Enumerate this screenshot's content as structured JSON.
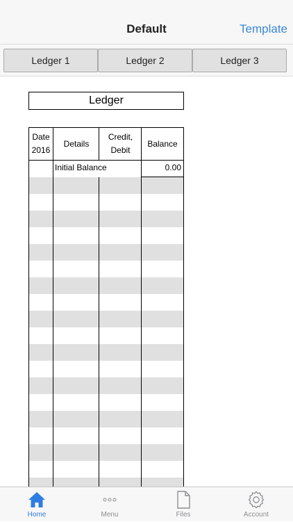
{
  "navbar": {
    "title": "Default",
    "right_button": "Template"
  },
  "tabs": [
    "Ledger 1",
    "Ledger 2",
    "Ledger 3"
  ],
  "ledger": {
    "title": "Ledger",
    "headers": {
      "date_line1": "Date",
      "date_line2": "2016",
      "details": "Details",
      "credit_line1": "Credit,",
      "credit_line2": "Debit",
      "balance": "Balance"
    },
    "initial_row": {
      "label": "Initial Balance",
      "value": "0.00"
    }
  },
  "tabbar": {
    "items": [
      {
        "label": "Home",
        "icon": "home-icon",
        "active": true
      },
      {
        "label": "Menu",
        "icon": "ellipsis-icon",
        "active": false
      },
      {
        "label": "Files",
        "icon": "file-icon",
        "active": false
      },
      {
        "label": "Account",
        "icon": "gear-icon",
        "active": false
      }
    ]
  },
  "colors": {
    "accent": "#2f7de1",
    "link": "#3b88d8",
    "stripe": "#e0e0e0"
  }
}
